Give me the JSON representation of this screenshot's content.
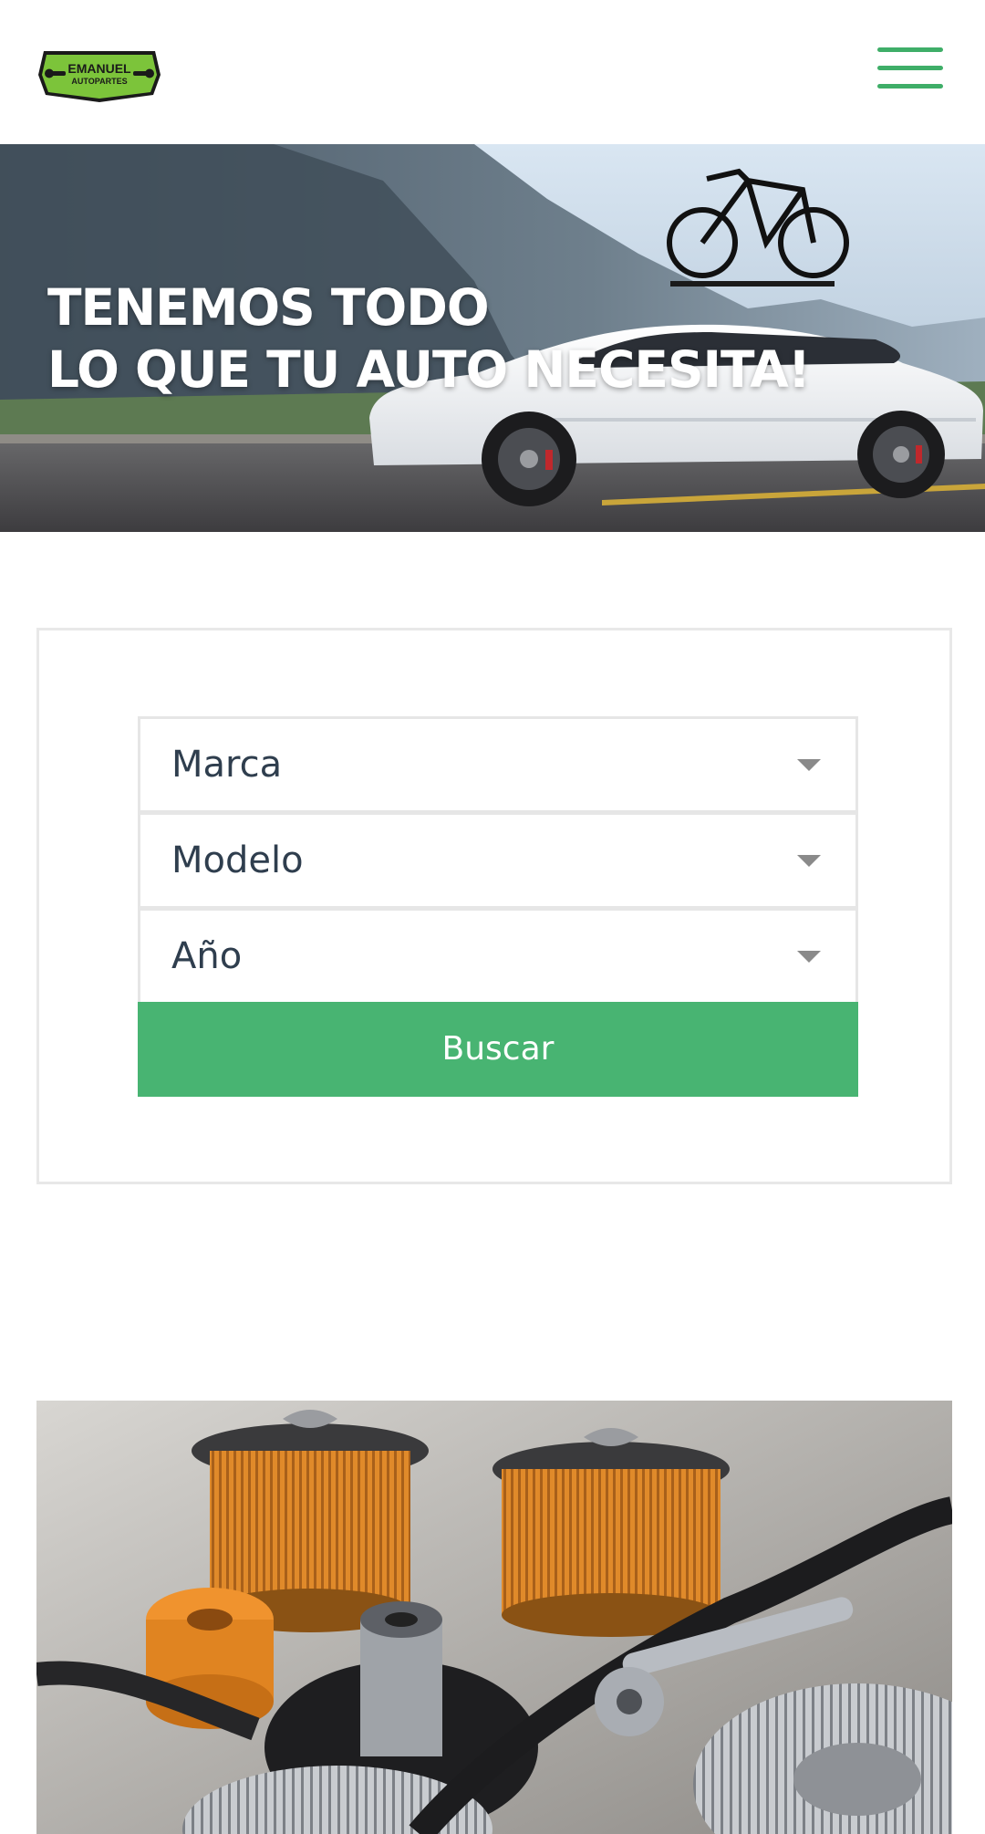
{
  "brand": {
    "logo_line1": "EMANUEL",
    "logo_line2": "AUTOPARTES",
    "accent_color": "#48b472",
    "logo_color": "#7cc43a"
  },
  "header": {
    "menu_icon": "hamburger-menu-icon"
  },
  "hero": {
    "title_line1": "TENEMOS TODO",
    "title_line2": "LO QUE TU AUTO NECESITA!",
    "image": "white-car-with-bike-rack-on-mountain-road"
  },
  "search": {
    "fields": [
      {
        "label": "Marca"
      },
      {
        "label": "Modelo"
      },
      {
        "label": "Año"
      }
    ],
    "button_label": "Buscar"
  },
  "parts_image": {
    "image": "auto-parts-filters-and-tools"
  }
}
